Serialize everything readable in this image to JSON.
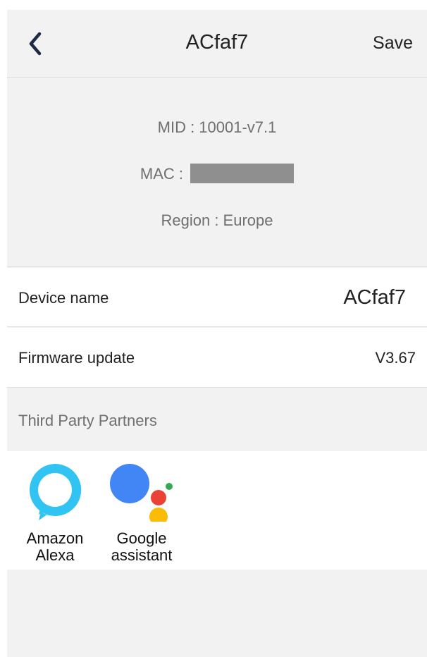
{
  "header": {
    "title": "ACfaf7",
    "save_label": "Save",
    "back_icon": "chevron-left-icon"
  },
  "device_info": {
    "mid": "MID : 10001-v7.1",
    "mac_label": "MAC :",
    "region": "Region : Europe"
  },
  "settings": {
    "device_name_label": "Device name",
    "device_name_value": "ACfaf7",
    "firmware_label": "Firmware update",
    "firmware_value": "V3.67"
  },
  "partners": {
    "section_title": "Third Party Partners",
    "items": [
      {
        "label_line1": "Amazon",
        "label_line2": "Alexa",
        "icon": "amazon-alexa-icon"
      },
      {
        "label_line1": "Google",
        "label_line2": "assistant",
        "icon": "google-assistant-icon"
      }
    ]
  },
  "colors": {
    "background": "#f2f2f2",
    "alexa": "#31c4f3",
    "google_blue": "#4285f4",
    "google_red": "#ea4335",
    "google_yellow": "#fbbc05",
    "google_green": "#34a853",
    "mac_mask": "#8f8f8f"
  }
}
